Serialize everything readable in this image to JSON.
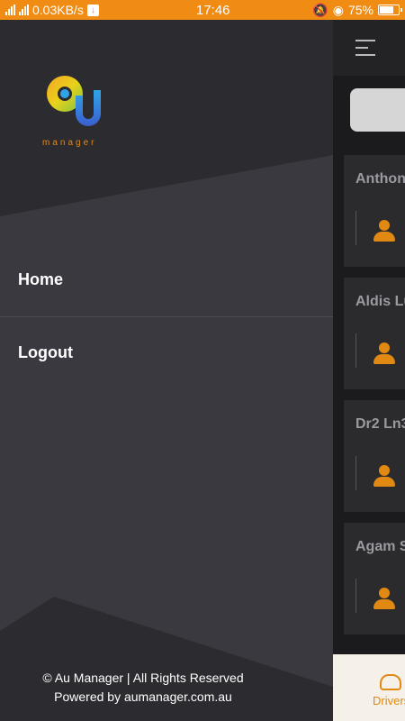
{
  "status_bar": {
    "network_speed": "0.03KB/s",
    "time": "17:46",
    "battery": "75%"
  },
  "drawer": {
    "logo_text": "manager",
    "menu": [
      {
        "label": "Home"
      },
      {
        "label": "Logout"
      }
    ],
    "footer": {
      "line1": "© Au Manager | All Rights Reserved",
      "line2": "Powered by aumanager.com.au"
    }
  },
  "background_app": {
    "cards": [
      {
        "name": "Anthon"
      },
      {
        "name": "Aldis Lu"
      },
      {
        "name": "Dr2 Ln3"
      },
      {
        "name": "Agam S"
      }
    ],
    "bottom_nav_label": "Drivers"
  },
  "colors": {
    "status_bar": "#f08c14",
    "drawer_bg": "#3a3940",
    "accent": "#e08a14"
  }
}
